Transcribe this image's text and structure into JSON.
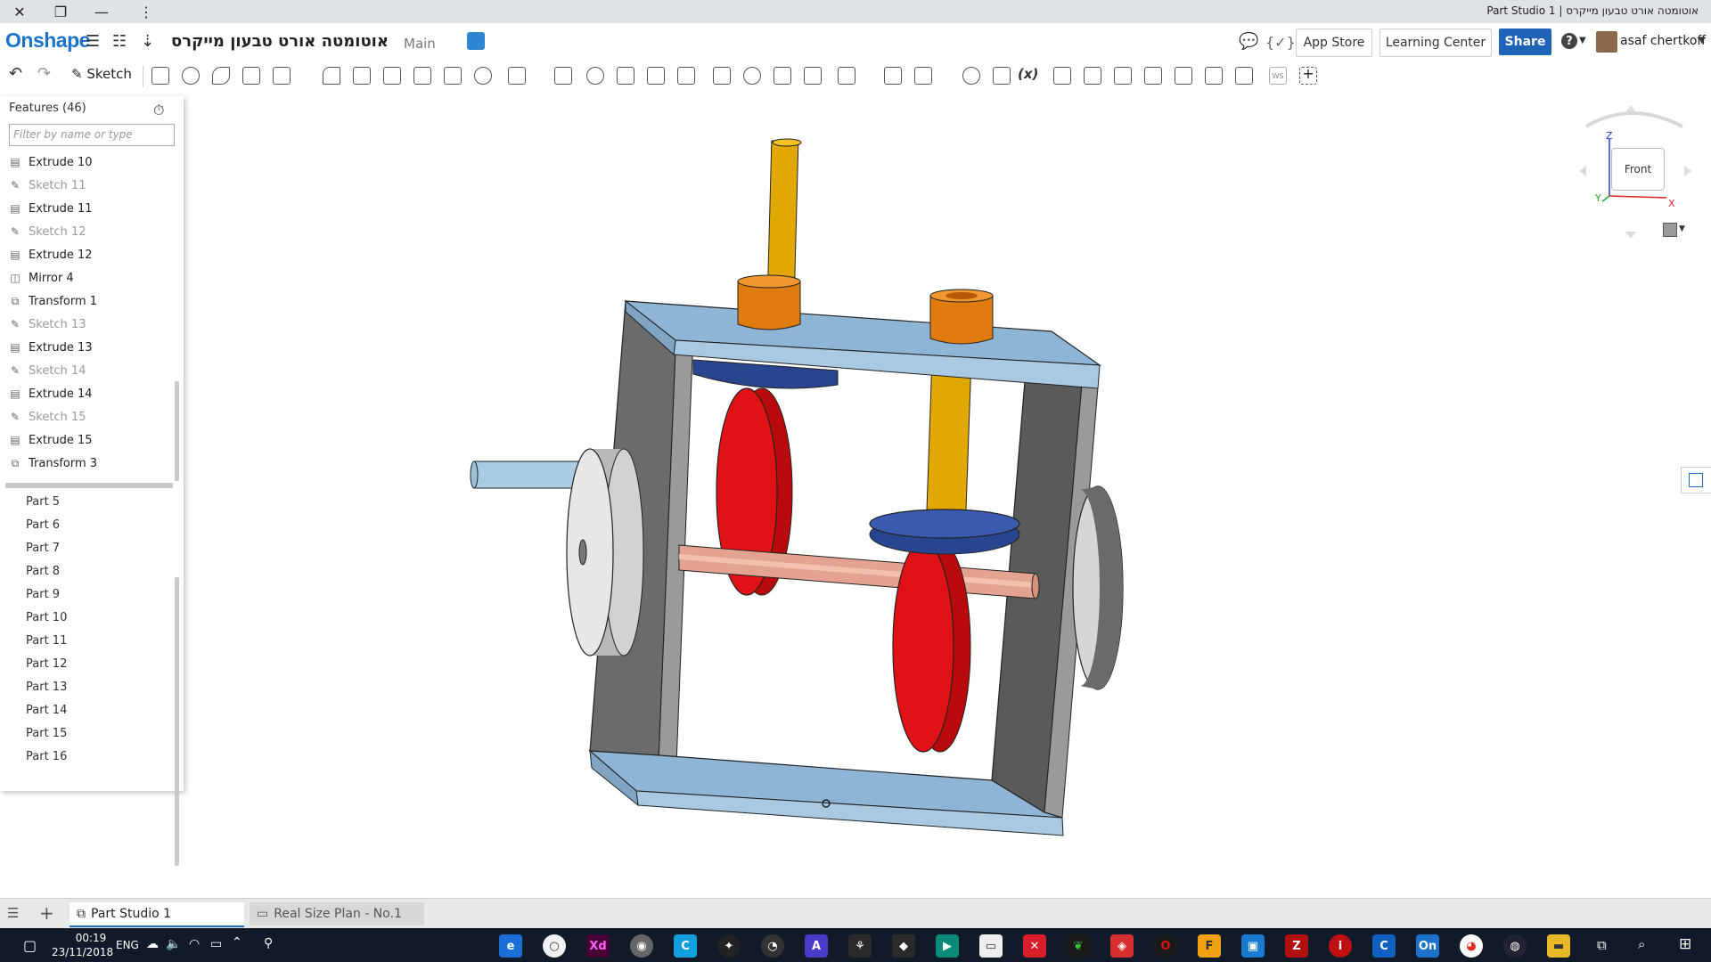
{
  "window": {
    "title": "Part Studio 1 | אוטומטה אורט טבעון מייקרס",
    "close_glyph": "✕",
    "restore_glyph": "❐",
    "minimize_glyph": "—",
    "menu_glyph": "⋮"
  },
  "header": {
    "logo": "Onshape",
    "document_title": "אוטומטה אורט טבעון מייקרס",
    "branch": "Main",
    "app_store_label": "App Store",
    "learning_center_label": "Learning Center",
    "share_label": "Share",
    "help_glyph": "?",
    "username": "asaf chertkoff"
  },
  "toolbar": {
    "sketch_label": "Sketch",
    "workspace_label": "WS",
    "variable_label": "(x)"
  },
  "features_panel": {
    "title": "Features (46)",
    "filter_placeholder": "Filter by name or type",
    "features": [
      {
        "label": "Extrude 10",
        "icon": "extrude-icon",
        "dim": false
      },
      {
        "label": "Sketch 11",
        "icon": "sketch-icon",
        "dim": true
      },
      {
        "label": "Extrude 11",
        "icon": "extrude-icon",
        "dim": false
      },
      {
        "label": "Sketch 12",
        "icon": "sketch-icon",
        "dim": true
      },
      {
        "label": "Extrude 12",
        "icon": "extrude-icon",
        "dim": false
      },
      {
        "label": "Mirror 4",
        "icon": "mirror-icon",
        "dim": false
      },
      {
        "label": "Transform 1",
        "icon": "transform-icon",
        "dim": false
      },
      {
        "label": "Sketch 13",
        "icon": "sketch-icon",
        "dim": true
      },
      {
        "label": "Extrude 13",
        "icon": "extrude-icon",
        "dim": false
      },
      {
        "label": "Sketch 14",
        "icon": "sketch-icon",
        "dim": true
      },
      {
        "label": "Extrude 14",
        "icon": "extrude-icon",
        "dim": false
      },
      {
        "label": "Sketch 15",
        "icon": "sketch-icon",
        "dim": true
      },
      {
        "label": "Extrude 15",
        "icon": "extrude-icon",
        "dim": false
      },
      {
        "label": "Transform 3",
        "icon": "transform-icon",
        "dim": false
      }
    ],
    "parts": [
      "Part 5",
      "Part 6",
      "Part 7",
      "Part 8",
      "Part 9",
      "Part 10",
      "Part 11",
      "Part 12",
      "Part 13",
      "Part 14",
      "Part 15",
      "Part 16"
    ]
  },
  "view_cube": {
    "face": "Front",
    "axis_z": "Z",
    "axis_x": "X",
    "axis_y": "Y"
  },
  "tabs": {
    "tab1": "Part Studio 1",
    "tab2": "Real Size Plan - No.1"
  },
  "taskbar": {
    "time": "00:19",
    "date": "23/11/2018",
    "language": "ENG"
  },
  "colors": {
    "brand_blue": "#1a73c8",
    "share_blue": "#1e63b8",
    "frame_blue": "#8fb5d6",
    "frame_gray": "#6f6f6f",
    "cam_red": "#d80e10",
    "shaft_gold": "#e0a800",
    "bushing_orange": "#e07b10",
    "follower_navy": "#2a4a96",
    "axle_copper": "#e09a80",
    "taskbar": "#101a29"
  }
}
